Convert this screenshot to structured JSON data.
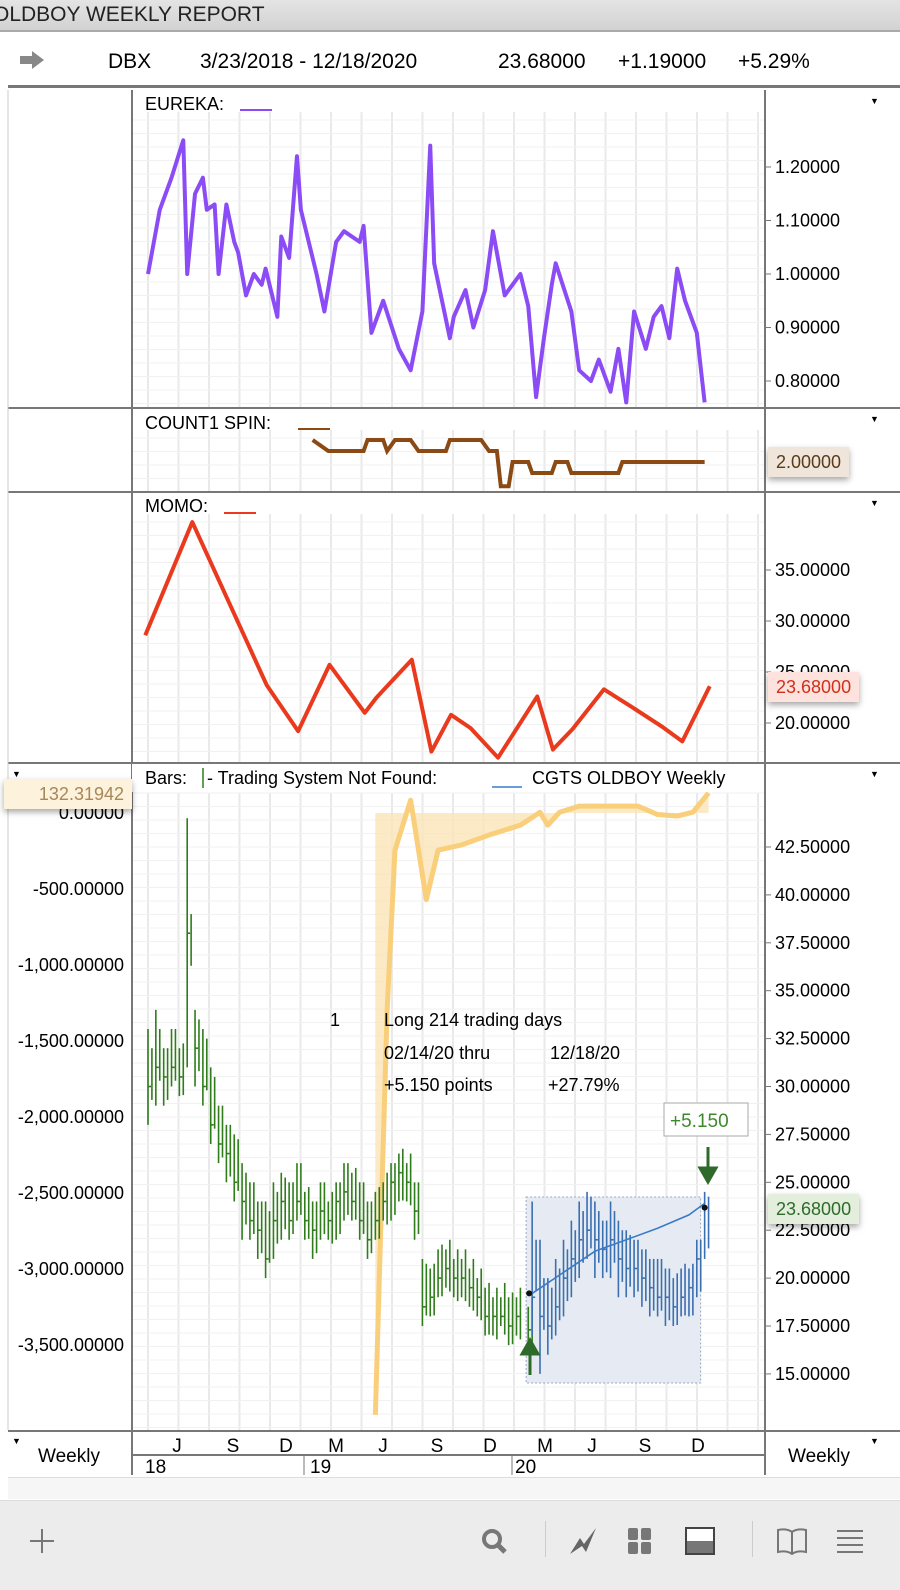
{
  "window": {
    "title": "OLDBOY WEEKLY REPORT"
  },
  "info": {
    "symbol": "DBX",
    "range": "3/23/2018 - 12/18/2020",
    "last": "23.68000",
    "change": "+1.19000",
    "pct": "+5.29%"
  },
  "panels": {
    "eureka": {
      "label": "EUREKA:",
      "color": "#8b4cf5"
    },
    "count1": {
      "label": "COUNT1 SPIN:",
      "color": "#8b4a14",
      "badge": "2.00000"
    },
    "momo": {
      "label": "MOMO:",
      "color": "#ea3a1e",
      "badge": "23.68000"
    },
    "bars": {
      "label_a": "Bars:",
      "label_b": "- Trading System Not Found:",
      "label_c": "CGTS OLDBOY Weekly",
      "badge_right": "23.68000",
      "badge_left": "132.31942"
    }
  },
  "annotations": {
    "trade_no": "1",
    "line1": "Long 214 trading days",
    "line2a": "02/14/20 thru",
    "line2b": "12/18/20",
    "line3a": "+5.150 points",
    "line3b": "+27.79%",
    "gain_box": "+5.150"
  },
  "x_axis": {
    "months": [
      "J",
      "S",
      "D",
      "M",
      "J",
      "S",
      "D",
      "M",
      "J",
      "S",
      "D"
    ],
    "years": [
      "18",
      "19",
      "20"
    ],
    "left_period": "Weekly",
    "right_period": "Weekly"
  },
  "footer": {
    "icons": [
      "plus-icon",
      "search-icon",
      "chart-icon",
      "grid-icon",
      "panel-icon",
      "book-icon",
      "menu-icon"
    ]
  },
  "chart_data": [
    {
      "type": "line",
      "name": "EUREKA",
      "yticks": [
        "1.20000",
        "1.10000",
        "1.00000",
        "0.90000",
        "0.80000"
      ],
      "ytick_values": [
        1.2,
        1.1,
        1.0,
        0.9,
        0.8
      ],
      "points": [
        [
          0,
          1.0
        ],
        [
          3,
          1.12
        ],
        [
          6,
          1.18
        ],
        [
          9,
          1.25
        ],
        [
          10,
          1.0
        ],
        [
          12,
          1.15
        ],
        [
          14,
          1.18
        ],
        [
          15,
          1.12
        ],
        [
          17,
          1.13
        ],
        [
          18,
          1.0
        ],
        [
          20,
          1.13
        ],
        [
          22,
          1.06
        ],
        [
          23,
          1.04
        ],
        [
          25,
          0.96
        ],
        [
          27,
          1.0
        ],
        [
          29,
          0.98
        ],
        [
          30,
          1.01
        ],
        [
          33,
          0.92
        ],
        [
          34,
          1.07
        ],
        [
          36,
          1.03
        ],
        [
          38,
          1.22
        ],
        [
          39,
          1.12
        ],
        [
          43,
          1.0
        ],
        [
          45,
          0.93
        ],
        [
          48,
          1.06
        ],
        [
          50,
          1.08
        ],
        [
          54,
          1.06
        ],
        [
          55,
          1.09
        ],
        [
          57,
          0.89
        ],
        [
          60,
          0.95
        ],
        [
          64,
          0.86
        ],
        [
          67,
          0.82
        ],
        [
          70,
          0.93
        ],
        [
          72,
          1.24
        ],
        [
          73,
          1.02
        ],
        [
          77,
          0.88
        ],
        [
          78,
          0.92
        ],
        [
          81,
          0.97
        ],
        [
          83,
          0.9
        ],
        [
          86,
          0.97
        ],
        [
          88,
          1.08
        ],
        [
          91,
          0.96
        ],
        [
          95,
          1.0
        ],
        [
          97,
          0.94
        ],
        [
          99,
          0.77
        ],
        [
          101,
          0.88
        ],
        [
          103,
          0.98
        ],
        [
          104,
          1.02
        ],
        [
          108,
          0.93
        ],
        [
          110,
          0.82
        ],
        [
          113,
          0.8
        ],
        [
          115,
          0.84
        ],
        [
          118,
          0.78
        ],
        [
          120,
          0.86
        ],
        [
          122,
          0.76
        ],
        [
          124,
          0.93
        ],
        [
          127,
          0.86
        ],
        [
          129,
          0.92
        ],
        [
          131,
          0.94
        ],
        [
          133,
          0.88
        ],
        [
          135,
          1.01
        ],
        [
          137,
          0.95
        ],
        [
          140,
          0.89
        ],
        [
          142,
          0.76
        ]
      ]
    },
    {
      "type": "step",
      "name": "COUNT1 SPIN",
      "points": [
        [
          42,
          3
        ],
        [
          46,
          2.5
        ],
        [
          55,
          2.5
        ],
        [
          56,
          3
        ],
        [
          60,
          3
        ],
        [
          61,
          2.5
        ],
        [
          63,
          3
        ],
        [
          67,
          3
        ],
        [
          69,
          2.5
        ],
        [
          76,
          2.5
        ],
        [
          77,
          3
        ],
        [
          85,
          3
        ],
        [
          87,
          2.5
        ],
        [
          89,
          2.5
        ],
        [
          90,
          0.9
        ],
        [
          92,
          0.9
        ],
        [
          93,
          2
        ],
        [
          97,
          2
        ],
        [
          98,
          1.5
        ],
        [
          103,
          1.5
        ],
        [
          104,
          2
        ],
        [
          107,
          2
        ],
        [
          108,
          1.5
        ],
        [
          120,
          1.5
        ],
        [
          121,
          2
        ],
        [
          142,
          2
        ]
      ]
    },
    {
      "type": "line",
      "name": "MOMO",
      "yticks": [
        "35.00000",
        "30.00000",
        "25.00000",
        "20.00000"
      ],
      "ytick_values": [
        35,
        30,
        25,
        20
      ],
      "points": [
        [
          -1,
          28.6
        ],
        [
          11,
          39.7
        ],
        [
          30,
          23.7
        ],
        [
          38,
          19.2
        ],
        [
          46,
          25.7
        ],
        [
          55,
          21
        ],
        [
          58,
          22.5
        ],
        [
          67,
          26.2
        ],
        [
          72,
          17.2
        ],
        [
          77,
          20.8
        ],
        [
          82,
          19.5
        ],
        [
          89,
          16.6
        ],
        [
          99,
          22.6
        ],
        [
          103,
          17.4
        ],
        [
          108,
          19.4
        ],
        [
          116,
          23.3
        ],
        [
          123,
          21.6
        ],
        [
          131,
          19.6
        ],
        [
          136,
          18.2
        ],
        [
          143,
          23.6
        ]
      ]
    },
    {
      "type": "ohlc",
      "name": "DBX Weekly Bars",
      "yticks": [
        "42.50000",
        "40.00000",
        "37.50000",
        "35.00000",
        "32.50000",
        "30.00000",
        "27.50000",
        "25.00000",
        "22.50000",
        "20.00000",
        "17.50000",
        "15.00000"
      ],
      "ytick_values": [
        42.5,
        40,
        37.5,
        35,
        32.5,
        30,
        27.5,
        25,
        22.5,
        20,
        17.5,
        15
      ],
      "bars_lhc": [
        [
          0,
          28,
          33,
          30
        ],
        [
          2,
          29,
          34,
          31
        ],
        [
          4,
          29,
          32,
          30.5
        ],
        [
          6,
          30,
          33,
          31
        ],
        [
          8,
          29.5,
          32,
          30.5
        ],
        [
          10,
          31,
          44,
          38
        ],
        [
          12,
          30,
          34,
          32
        ],
        [
          14,
          29,
          33,
          30
        ],
        [
          16,
          27,
          31,
          28
        ],
        [
          18,
          26,
          29,
          27
        ],
        [
          20,
          25,
          28,
          26.5
        ],
        [
          22,
          24,
          27.5,
          25
        ],
        [
          24,
          22,
          26,
          24
        ],
        [
          26,
          22,
          25,
          23
        ],
        [
          28,
          21,
          24,
          22.5
        ],
        [
          30,
          20,
          24,
          21
        ],
        [
          32,
          21,
          25,
          23
        ],
        [
          34,
          22,
          25.5,
          24
        ],
        [
          36,
          22,
          25,
          23
        ],
        [
          38,
          23,
          26,
          24
        ],
        [
          40,
          22,
          24.5,
          23
        ],
        [
          42,
          21,
          24,
          22.5
        ],
        [
          44,
          22,
          25,
          23.5
        ],
        [
          46,
          22,
          24,
          23
        ],
        [
          48,
          22,
          25,
          24
        ],
        [
          50,
          23,
          26,
          24.5
        ],
        [
          52,
          23,
          25.5,
          24
        ],
        [
          54,
          22,
          25,
          23
        ],
        [
          56,
          21,
          24,
          22
        ],
        [
          58,
          22,
          24.5,
          23
        ],
        [
          60,
          23,
          25,
          24
        ],
        [
          62,
          23,
          26,
          25
        ],
        [
          64,
          24,
          26.5,
          25.5
        ],
        [
          66,
          24,
          26,
          25
        ],
        [
          68,
          22,
          25,
          23.5
        ],
        [
          70,
          17.5,
          21,
          18.5
        ],
        [
          72,
          18,
          20.5,
          19
        ],
        [
          74,
          19,
          21.5,
          20
        ],
        [
          76,
          19.5,
          21.5,
          20.5
        ],
        [
          78,
          19,
          21,
          20
        ],
        [
          80,
          19,
          21,
          20
        ],
        [
          82,
          18.5,
          20.5,
          19.5
        ],
        [
          84,
          18,
          20,
          19
        ],
        [
          86,
          17,
          19.5,
          18
        ],
        [
          88,
          17,
          19,
          18
        ],
        [
          90,
          17.5,
          19,
          18
        ],
        [
          92,
          16.5,
          19,
          17.5
        ],
        [
          94,
          17,
          19,
          18
        ],
        [
          97,
          16.5,
          18.5,
          17.3
        ]
      ],
      "trade_bars_lhc": [
        [
          98,
          17,
          24,
          19
        ],
        [
          100,
          15,
          22,
          18
        ],
        [
          102,
          16,
          20,
          17.5
        ],
        [
          104,
          17,
          21,
          18.5
        ],
        [
          106,
          18,
          22,
          20
        ],
        [
          108,
          19,
          23,
          21
        ],
        [
          110,
          20,
          24,
          22
        ],
        [
          112,
          21,
          24.5,
          22.5
        ],
        [
          114,
          20,
          24,
          22
        ],
        [
          116,
          20,
          23,
          21.5
        ],
        [
          118,
          20,
          24,
          22
        ],
        [
          120,
          19,
          23,
          21
        ],
        [
          122,
          19,
          22.5,
          20.5
        ],
        [
          124,
          19,
          22,
          20.5
        ],
        [
          126,
          18.5,
          21.5,
          20
        ],
        [
          128,
          18,
          21,
          19.5
        ],
        [
          130,
          18,
          21,
          19
        ],
        [
          132,
          17.5,
          20.5,
          19
        ],
        [
          134,
          17.5,
          20,
          18.5
        ],
        [
          136,
          18,
          20.5,
          19
        ],
        [
          138,
          18,
          20.5,
          19.5
        ],
        [
          140,
          19,
          22,
          21
        ],
        [
          142,
          21,
          24.5,
          23.68
        ]
      ],
      "trade_ma": [
        [
          98,
          19.2
        ],
        [
          106,
          20.3
        ],
        [
          114,
          21.4
        ],
        [
          122,
          22.0
        ],
        [
          130,
          22.6
        ],
        [
          138,
          23.3
        ],
        [
          142,
          23.9
        ]
      ],
      "equity_yticks": [
        "0.00000",
        "-500.00000",
        "-1,000.00000",
        "-1,500.00000",
        "-2,000.00000",
        "-2,500.00000",
        "-3,000.00000",
        "-3,500.00000"
      ],
      "equity_ytick_values": [
        0,
        -500,
        -1000,
        -1500,
        -2000,
        -2500,
        -3000,
        -3500
      ],
      "equity": [
        [
          58,
          -3960
        ],
        [
          61,
          -1300
        ],
        [
          63,
          -245
        ],
        [
          67,
          85
        ],
        [
          71,
          -570
        ],
        [
          74,
          -245
        ],
        [
          80,
          -210
        ],
        [
          87,
          -145
        ],
        [
          95,
          -80
        ],
        [
          100,
          5
        ],
        [
          102,
          -80
        ],
        [
          105,
          5
        ],
        [
          110,
          45
        ],
        [
          125,
          45
        ],
        [
          130,
          -10
        ],
        [
          135,
          -20
        ],
        [
          139,
          5
        ],
        [
          143,
          132
        ]
      ]
    }
  ]
}
